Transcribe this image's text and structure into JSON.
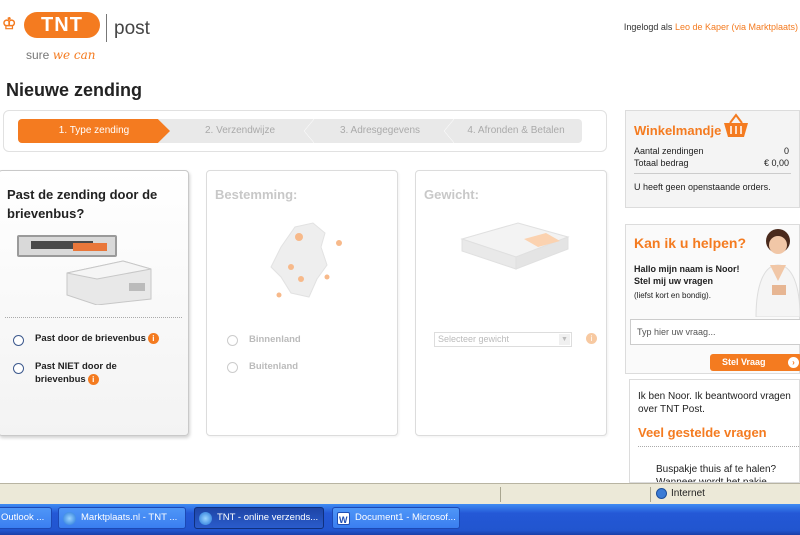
{
  "header": {
    "logo_crown": "♔",
    "logo_brand": "TNT",
    "logo_post": "post",
    "tagline_prefix": "sure",
    "tagline_emph": "we can",
    "logged_in_prefix": "Ingelogd als",
    "logged_in_user": "Leo de Kaper (via Marktplaats)"
  },
  "page_title": "Nieuwe zending",
  "steps": [
    {
      "label": "1. Type zending",
      "active": true
    },
    {
      "label": "2. Verzendwijze",
      "active": false
    },
    {
      "label": "3. Adresgegevens",
      "active": false
    },
    {
      "label": "4. Afronden & Betalen",
      "active": false
    }
  ],
  "card_size": {
    "title": "Past de zending door de brievenbus?",
    "option_1": "Past door de brievenbus",
    "option_2": "Past NIET door de brievenbus"
  },
  "card_destination": {
    "title": "Bestemming:",
    "option_1": "Binnenland",
    "option_2": "Buitenland"
  },
  "card_weight": {
    "title": "Gewicht:",
    "select_value": "Selecteer gewicht"
  },
  "info_glyph": "i",
  "cart": {
    "title": "Winkelmandje",
    "count_label": "Aantal zendingen",
    "count_value": "0",
    "total_label": "Totaal bedrag",
    "total_value": "€ 0,00",
    "message": "U heeft geen openstaande orders."
  },
  "help": {
    "title": "Kan ik u helpen?",
    "greeting": "Hallo mijn naam is Noor! Stel mij uw vragen",
    "hint": "(liefst kort en bondig).",
    "input_value": "Typ hier uw vraag...",
    "ask_button": "Stel Vraag",
    "go_glyph": "›"
  },
  "faq": {
    "intro": "Ik ben Noor. Ik beantwoord vragen over TNT Post.",
    "title": "Veel gestelde vragen",
    "item_1": "Buspakje thuis af te halen? Wanneer wordt het pakje"
  },
  "statusbar": {
    "zone": "Internet"
  },
  "taskbar": [
    {
      "label": "Outlook ...",
      "icon": "outlook-icon"
    },
    {
      "label": "Marktplaats.nl - TNT ...",
      "icon": "ie-icon"
    },
    {
      "label": "TNT - online verzends...",
      "icon": "ie-icon",
      "active": true
    },
    {
      "label": "Document1 - Microsof...",
      "icon": "word-icon"
    }
  ],
  "colors": {
    "accent": "#f47b20",
    "taskbar": "#2458d6"
  }
}
